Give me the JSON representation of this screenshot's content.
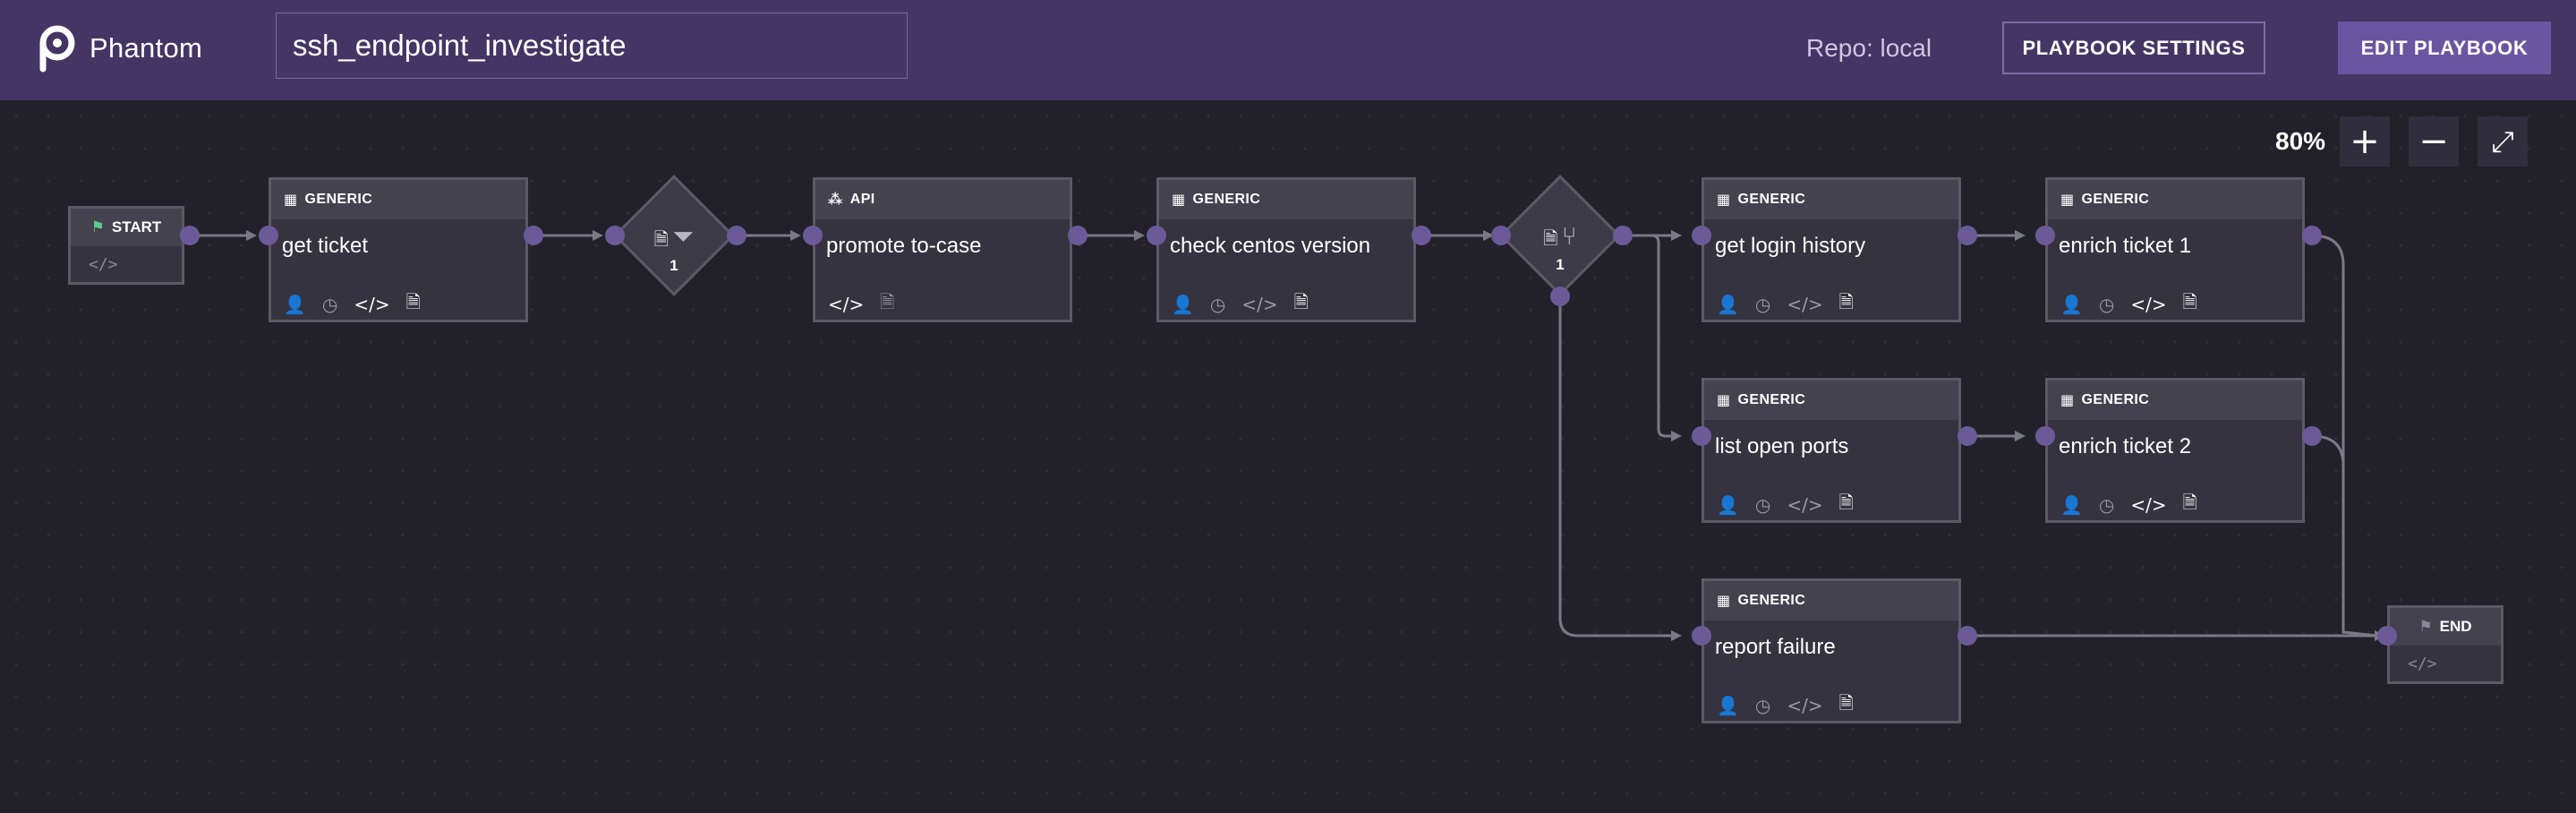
{
  "app": {
    "name": "Phantom"
  },
  "playbook": {
    "name": "ssh_endpoint_investigate"
  },
  "header": {
    "repo_label": "Repo: local",
    "settings_label": "PLAYBOOK SETTINGS",
    "edit_label": "EDIT PLAYBOOK"
  },
  "zoom": {
    "level": "80%",
    "zoom_in": "+",
    "zoom_out": "−",
    "fit": "⤢"
  },
  "start": {
    "label": "START",
    "code": "</>"
  },
  "end": {
    "label": "END",
    "code": "</>"
  },
  "decisions": [
    {
      "type": "filter",
      "count": "1"
    },
    {
      "type": "decision",
      "count": "1"
    }
  ],
  "blocks": [
    {
      "id": "get_ticket",
      "type": "GENERIC",
      "name": "get ticket"
    },
    {
      "id": "promote_to_case",
      "type": "API",
      "name": "promote to-case"
    },
    {
      "id": "check_centos_version",
      "type": "GENERIC",
      "name": "check centos version"
    },
    {
      "id": "get_login_history",
      "type": "GENERIC",
      "name": "get login history"
    },
    {
      "id": "enrich_ticket_1",
      "type": "GENERIC",
      "name": "enrich ticket 1"
    },
    {
      "id": "list_open_ports",
      "type": "GENERIC",
      "name": "list open ports"
    },
    {
      "id": "enrich_ticket_2",
      "type": "GENERIC",
      "name": "enrich ticket 2"
    },
    {
      "id": "report_failure",
      "type": "GENERIC",
      "name": "report failure"
    }
  ],
  "colors": {
    "header": "#443564",
    "canvas": "#22212a",
    "port": "#6b5a97",
    "start_flag": "#5cc98a",
    "accent_button": "#6a55a0"
  }
}
